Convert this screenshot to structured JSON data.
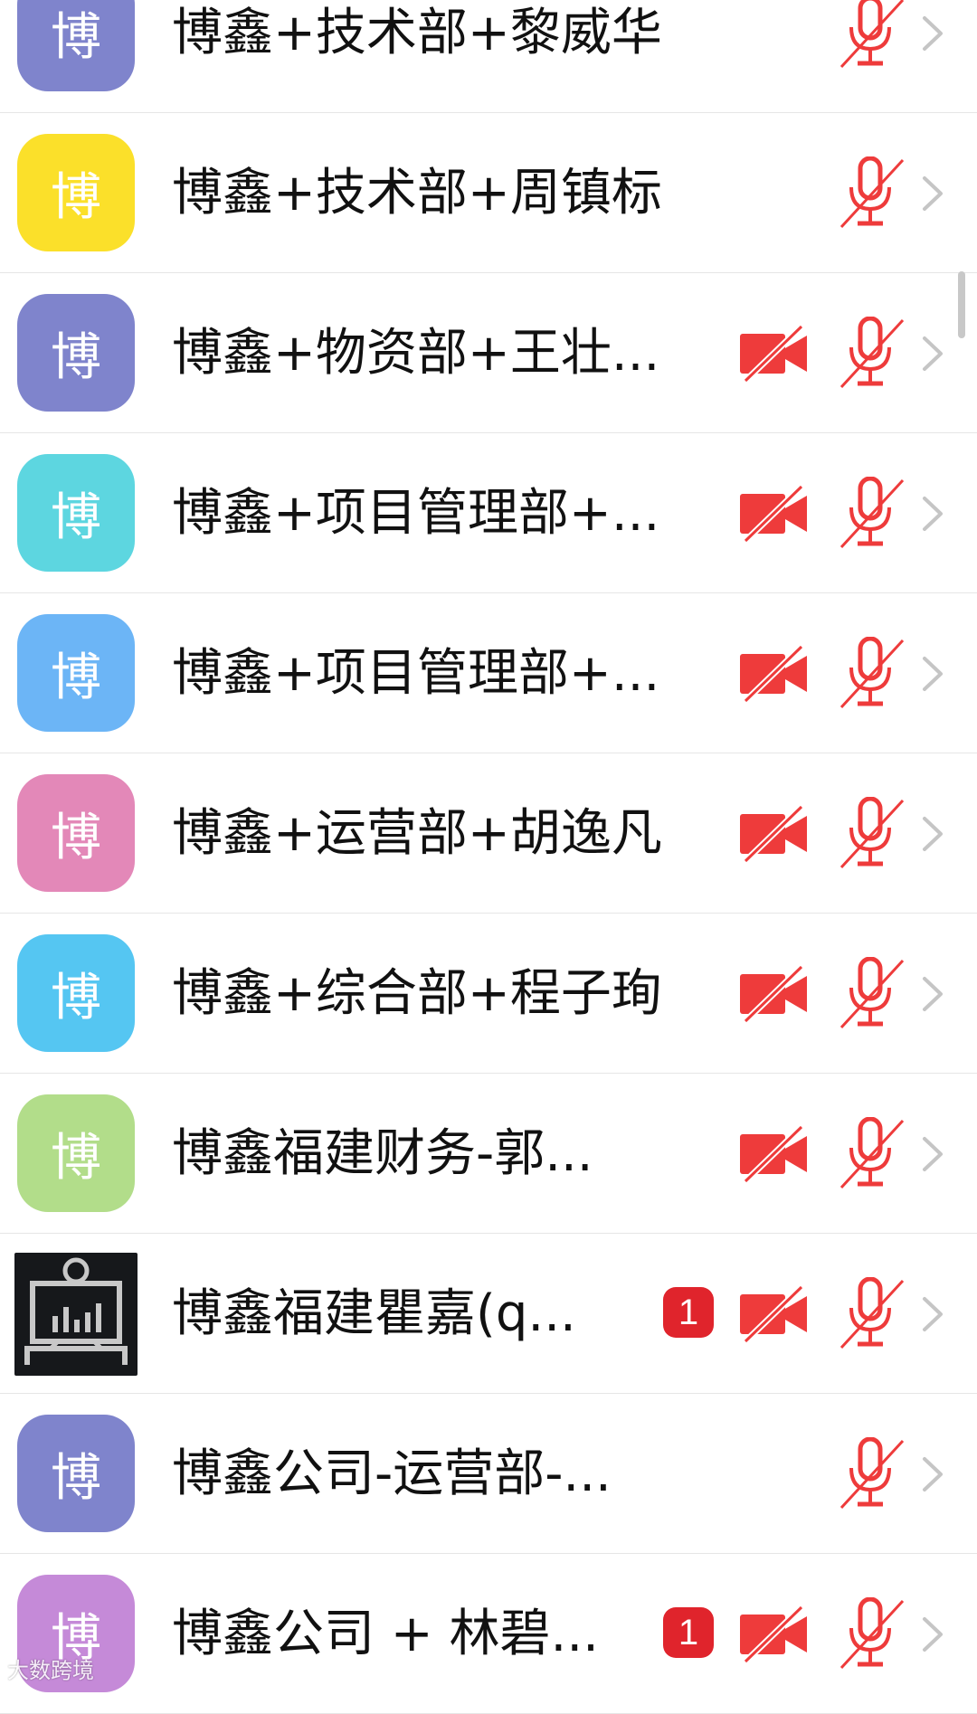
{
  "participants": [
    {
      "initial": "博",
      "avatar_color": "#7f84cc",
      "name": "博鑫+技术部+黎威华",
      "badge": "",
      "has_video": false,
      "mic_muted": true
    },
    {
      "initial": "博",
      "avatar_color": "#fbe02a",
      "name": "博鑫+技术部+周镇标",
      "badge": "",
      "has_video": false,
      "mic_muted": true
    },
    {
      "initial": "博",
      "avatar_color": "#7f84cc",
      "name": "博鑫+物资部+王壮...",
      "badge": "",
      "has_video": true,
      "mic_muted": true
    },
    {
      "initial": "博",
      "avatar_color": "#5dd6e0",
      "name": "博鑫+项目管理部+...",
      "badge": "",
      "has_video": true,
      "mic_muted": true
    },
    {
      "initial": "博",
      "avatar_color": "#6cb5f6",
      "name": "博鑫+项目管理部+...",
      "badge": "",
      "has_video": true,
      "mic_muted": true
    },
    {
      "initial": "博",
      "avatar_color": "#e388b8",
      "name": "博鑫+运营部+胡逸凡",
      "badge": "",
      "has_video": true,
      "mic_muted": true
    },
    {
      "initial": "博",
      "avatar_color": "#55c6f2",
      "name": "博鑫+综合部+程子珣",
      "badge": "",
      "has_video": true,
      "mic_muted": true
    },
    {
      "initial": "博",
      "avatar_color": "#b2dd8a",
      "name": "博鑫福建财务-郭...",
      "badge": "",
      "has_video": true,
      "mic_muted": true
    },
    {
      "initial": "",
      "avatar_color": "#16181b",
      "name": "博鑫福建瞿嘉(q...",
      "badge": "1",
      "has_video": true,
      "mic_muted": true,
      "device_avatar": true
    },
    {
      "initial": "博",
      "avatar_color": "#7f84cc",
      "name": "博鑫公司-运营部-...",
      "badge": "",
      "has_video": false,
      "mic_muted": true
    },
    {
      "initial": "博",
      "avatar_color": "#c58ad8",
      "name": "博鑫公司 + 林碧...",
      "badge": "1",
      "has_video": true,
      "mic_muted": true
    }
  ],
  "colors": {
    "muted_red": "#ee3b3b",
    "chevron": "#c5c5c5",
    "badge_red": "#e0242c"
  },
  "icons": {
    "camera": "video-off-icon",
    "mic": "mic-off-icon",
    "chevron": "chevron-right-icon"
  },
  "watermark": "大数跨境"
}
